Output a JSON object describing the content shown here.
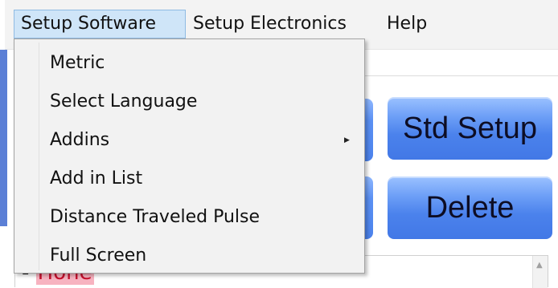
{
  "menubar": {
    "items": [
      {
        "label": "Setup Software",
        "active": true
      },
      {
        "label": "Setup Electronics"
      },
      {
        "label": "Help"
      }
    ]
  },
  "dropdown": {
    "items": [
      {
        "label": "Metric"
      },
      {
        "label": "Select Language"
      },
      {
        "label": "Addins",
        "has_submenu": true,
        "submenu_icon": "triangle-right-icon"
      },
      {
        "label": "Add in List"
      },
      {
        "label": "Distance Traveled Pulse"
      },
      {
        "label": "Full Screen"
      }
    ]
  },
  "buttons": {
    "std_setup": "Std Setup",
    "delete": "Delete"
  },
  "list": {
    "prefix": "-",
    "item_label": "Hone"
  },
  "colors": {
    "menu_highlight": "#cfe5f8",
    "button_blue": "#4b82ec",
    "list_item_highlight": "#f7b3c0",
    "list_item_text": "#c8102e"
  }
}
